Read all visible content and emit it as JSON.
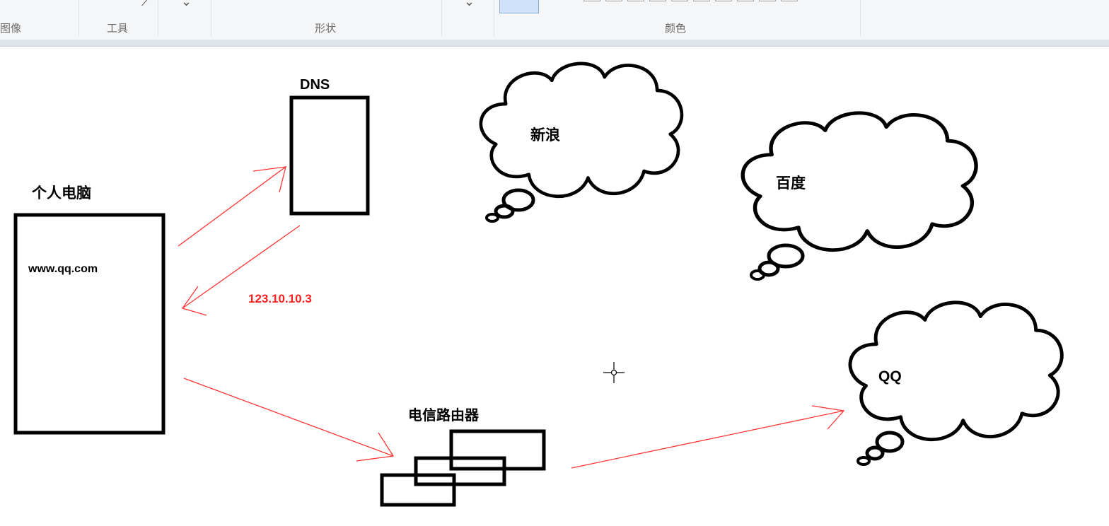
{
  "ribbon": {
    "groups": [
      {
        "label": "图像"
      },
      {
        "label": "工具"
      },
      {
        "label": "形状"
      },
      {
        "label": "颜色"
      }
    ]
  },
  "canvas": {
    "pc_label": "个人电脑",
    "url_label": "www.qq.com",
    "dns_label": "DNS",
    "ip_label": "123.10.10.3",
    "router_label": "电信路由器",
    "clouds": [
      {
        "label": "新浪"
      },
      {
        "label": "百度"
      },
      {
        "label": "QQ"
      }
    ]
  },
  "colors": {
    "stroke": "#000000",
    "arrow": "#ff3333",
    "ip_text": "#ff2020",
    "ribbon_bg": "#f5f6f7",
    "selected_color_fill": "#cfe2fa"
  }
}
